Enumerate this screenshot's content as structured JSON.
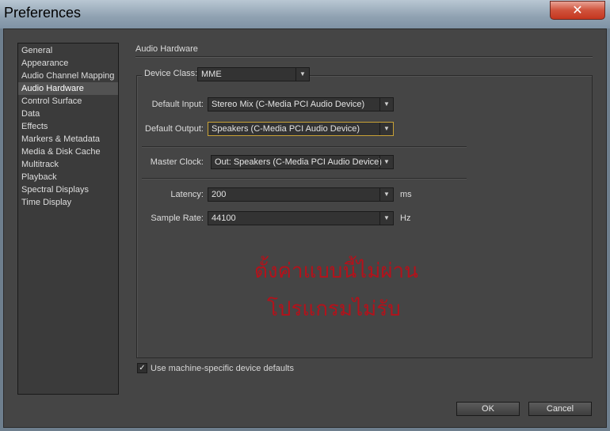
{
  "window": {
    "title": "Preferences",
    "close_glyph": "✕"
  },
  "sidebar": {
    "items": [
      {
        "label": "General"
      },
      {
        "label": "Appearance"
      },
      {
        "label": "Audio Channel Mapping"
      },
      {
        "label": "Audio Hardware",
        "selected": true
      },
      {
        "label": "Control Surface"
      },
      {
        "label": "Data"
      },
      {
        "label": "Effects"
      },
      {
        "label": "Markers & Metadata"
      },
      {
        "label": "Media & Disk Cache"
      },
      {
        "label": "Multitrack"
      },
      {
        "label": "Playback"
      },
      {
        "label": "Spectral Displays"
      },
      {
        "label": "Time Display"
      }
    ]
  },
  "panel": {
    "title": "Audio Hardware",
    "device_class": {
      "label": "Device Class:",
      "value": "MME"
    },
    "default_input": {
      "label": "Default Input:",
      "value": "Stereo Mix (C-Media PCI Audio Device)"
    },
    "default_output": {
      "label": "Default Output:",
      "value": "Speakers (C-Media PCI Audio Device)"
    },
    "master_clock": {
      "label": "Master Clock:",
      "value": "Out: Speakers (C-Media PCI Audio Device)"
    },
    "latency": {
      "label": "Latency:",
      "value": "200",
      "unit": "ms"
    },
    "sample_rate": {
      "label": "Sample Rate:",
      "value": "44100",
      "unit": "Hz"
    },
    "annotation_line1": "ตั้งค่าแบบนี้ไม่ผ่าน",
    "annotation_line2": "โปรแกรมไม่รับ",
    "annotation_color": "#b3121b",
    "use_defaults": {
      "label": "Use machine-specific device defaults",
      "checked": true,
      "check_glyph": "✓"
    }
  },
  "buttons": {
    "ok": "OK",
    "cancel": "Cancel"
  },
  "icons": {
    "dropdown_arrow": "▼"
  }
}
